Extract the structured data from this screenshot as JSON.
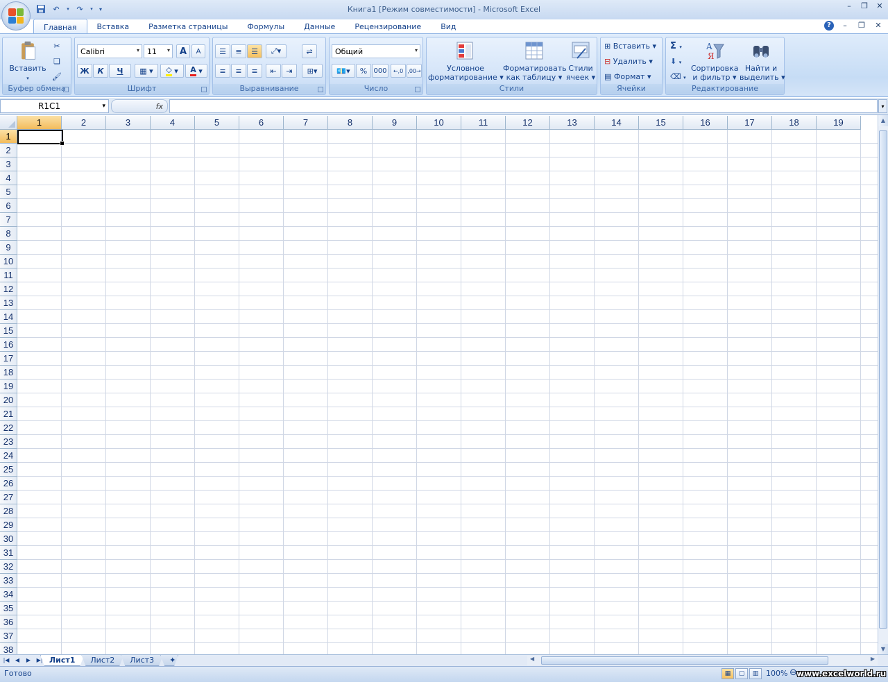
{
  "window": {
    "title": "Книга1  [Режим совместимости] - Microsoft Excel"
  },
  "ribbon": {
    "tabs": [
      "Главная",
      "Вставка",
      "Разметка страницы",
      "Формулы",
      "Данные",
      "Рецензирование",
      "Вид"
    ],
    "active_tab": "Главная",
    "clipboard": {
      "label": "Буфер обмена",
      "paste": "Вставить"
    },
    "font": {
      "label": "Шрифт",
      "name": "Calibri",
      "size": "11",
      "bold": "Ж",
      "italic": "К",
      "underline": "Ч",
      "grow": "A",
      "shrink": "A",
      "color_glyph": "A"
    },
    "alignment": {
      "label": "Выравнивание"
    },
    "number": {
      "label": "Число",
      "format": "Общий",
      "percent": "%",
      "thousands": "000"
    },
    "styles": {
      "label": "Стили",
      "conditional_1": "Условное",
      "conditional_2": "форматирование",
      "table_1": "Форматировать",
      "table_2": "как таблицу",
      "cell_1": "Стили",
      "cell_2": "ячеек"
    },
    "cells": {
      "label": "Ячейки",
      "insert": "Вставить",
      "delete": "Удалить",
      "format": "Формат"
    },
    "editing": {
      "label": "Редактирование",
      "sum": "Σ",
      "sort_1": "Сортировка",
      "sort_2": "и фильтр",
      "find_1": "Найти и",
      "find_2": "выделить"
    }
  },
  "formula_bar": {
    "name_box": "R1C1",
    "fx": "fx",
    "content": ""
  },
  "grid": {
    "columns": [
      "1",
      "2",
      "3",
      "4",
      "5",
      "6",
      "7",
      "8",
      "9",
      "10",
      "11",
      "12",
      "13",
      "14",
      "15",
      "16",
      "17",
      "18",
      "19"
    ],
    "rows": [
      "1",
      "2",
      "3",
      "4",
      "5",
      "6",
      "7",
      "8",
      "9",
      "10",
      "11",
      "12",
      "13",
      "14",
      "15",
      "16",
      "17",
      "18",
      "19",
      "20",
      "21",
      "22",
      "23",
      "24",
      "25",
      "26",
      "27",
      "28",
      "29",
      "30",
      "31",
      "32",
      "33",
      "34",
      "35",
      "36",
      "37",
      "38"
    ],
    "selected_column": "1",
    "selected_row": "1"
  },
  "sheets": {
    "tabs": [
      "Лист1",
      "Лист2",
      "Лист3"
    ],
    "active": "Лист1"
  },
  "status_bar": {
    "status": "Готово",
    "zoom": "100%",
    "watermark": "www.excelworld.ru"
  },
  "colors": {
    "ribbon_text": "#15428b",
    "selected_header": "#f3bc5c",
    "gridline": "#d0d7e5"
  }
}
